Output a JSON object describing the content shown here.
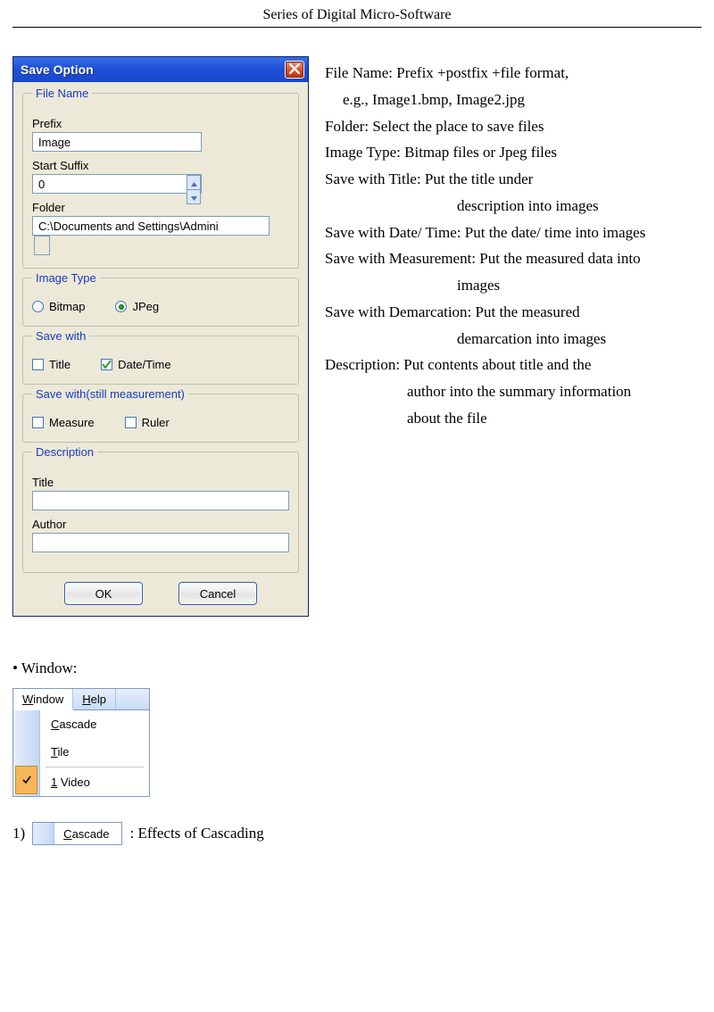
{
  "doc_header": "Series of Digital Micro-Software",
  "dialog": {
    "title": "Save Option",
    "file_name": {
      "legend": "File Name",
      "prefix_label": "Prefix",
      "prefix_value": "Image",
      "suffix_label": "Start Suffix",
      "suffix_value": "0",
      "folder_label": "Folder",
      "folder_value": "C:\\Documents and Settings\\Admini"
    },
    "image_type": {
      "legend": "Image Type",
      "bitmap_label": "Bitmap",
      "jpeg_label": "JPeg"
    },
    "save_with": {
      "legend": "Save with",
      "title_label": "Title",
      "datetime_label": "Date/Time"
    },
    "save_with_still": {
      "legend": "Save with(still measurement)",
      "measure_label": "Measure",
      "ruler_label": "Ruler"
    },
    "description": {
      "legend": "Description",
      "title_label": "Title",
      "title_value": "",
      "author_label": "Author",
      "author_value": ""
    },
    "buttons": {
      "ok": "OK",
      "cancel": "Cancel"
    }
  },
  "explain": {
    "l1": "File Name: Prefix +postfix +file format,",
    "l2": "e.g., Image1.bmp, Image2.jpg",
    "l3": "Folder: Select the place to save files",
    "l4": "Image Type: Bitmap files or Jpeg files",
    "l5": "Save with Title: Put the title under",
    "l6": "description into images",
    "l7": "Save with Date/ Time: Put the date/ time into images",
    "l8": "Save with Measurement: Put the measured data into",
    "l9": "images",
    "l10": "Save with Demarcation: Put the measured",
    "l11": "demarcation into images",
    "l12": "Description: Put contents about title and the",
    "l13": "author into the summary information",
    "l14": "about the file"
  },
  "window_section": {
    "bullet": "• Window:",
    "menubar": {
      "window": "Window",
      "help": "Help"
    },
    "items": {
      "cascade": "Cascade",
      "tile": "Tile",
      "video_num": "1",
      "video_word": " Video"
    },
    "footer_num": "1)",
    "footer_chip": "Cascade",
    "footer_text": ": Effects of Cascading"
  }
}
